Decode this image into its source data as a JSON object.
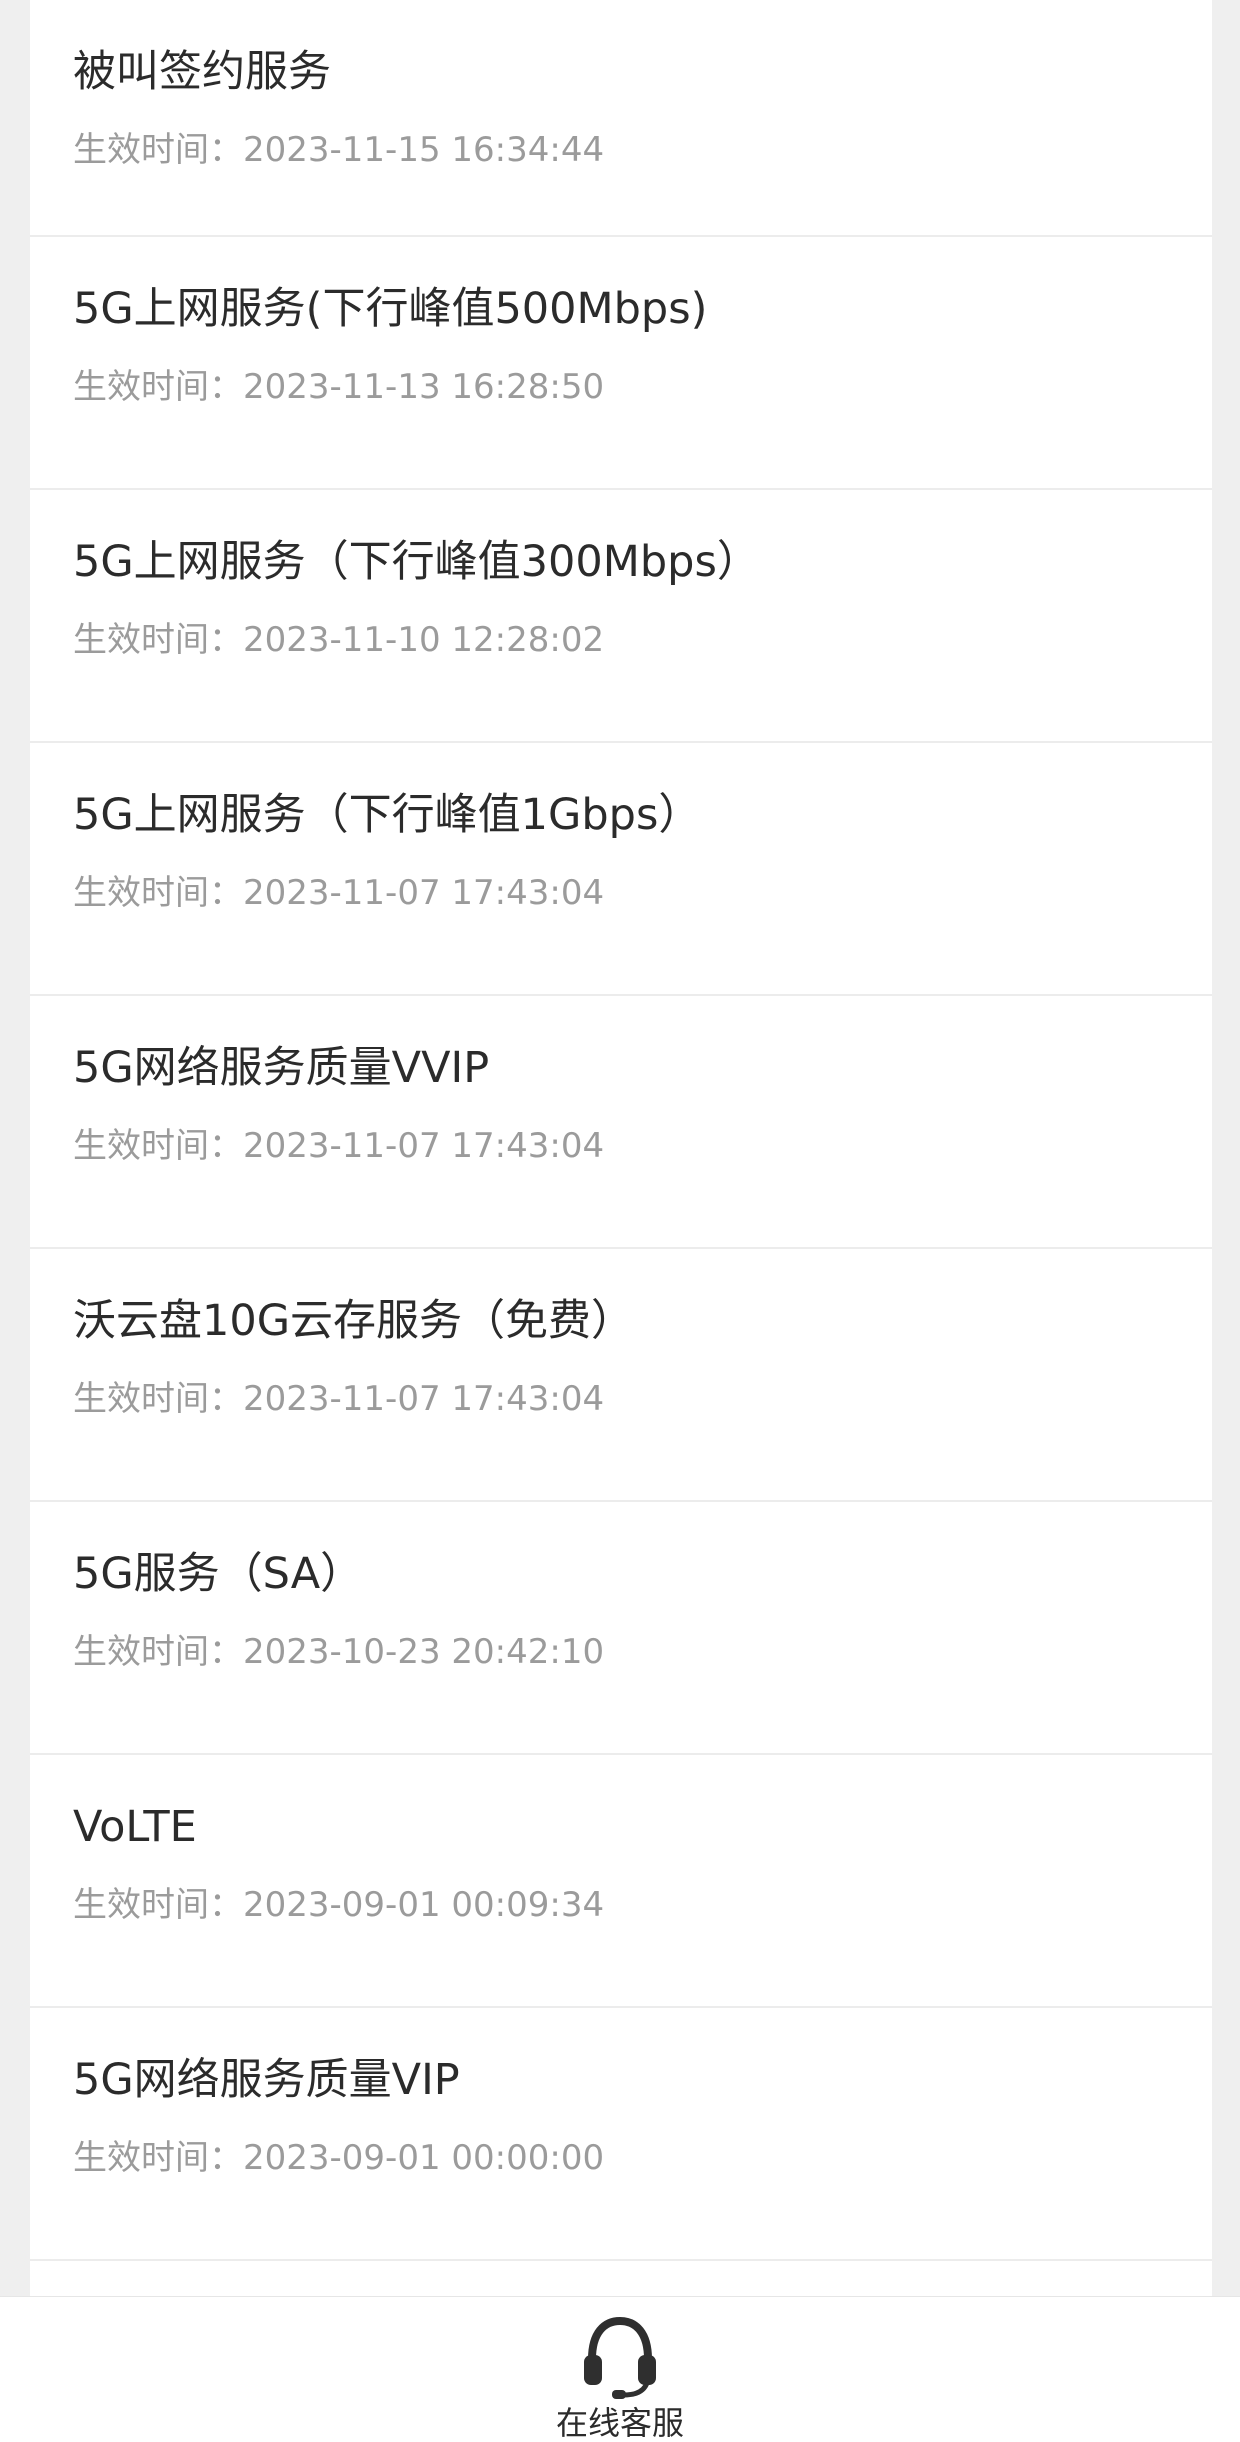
{
  "services": [
    {
      "name": "被叫签约服务",
      "time_label": "生效时间：",
      "time": "2023-11-15 16:34:44"
    },
    {
      "name": "5G上网服务(下行峰值500Mbps)",
      "time_label": "生效时间：",
      "time": "2023-11-13 16:28:50"
    },
    {
      "name": "5G上网服务（下行峰值300Mbps）",
      "time_label": "生效时间：",
      "time": "2023-11-10 12:28:02"
    },
    {
      "name": "5G上网服务（下行峰值1Gbps）",
      "time_label": "生效时间：",
      "time": "2023-11-07 17:43:04"
    },
    {
      "name": "5G网络服务质量VVIP",
      "time_label": "生效时间：",
      "time": "2023-11-07 17:43:04"
    },
    {
      "name": "沃云盘10G云存服务（免费）",
      "time_label": "生效时间：",
      "time": "2023-11-07 17:43:04"
    },
    {
      "name": "5G服务（SA）",
      "time_label": "生效时间：",
      "time": "2023-10-23 20:42:10"
    },
    {
      "name": "VoLTE",
      "time_label": "生效时间：",
      "time": "2023-09-01 00:09:34"
    },
    {
      "name": "5G网络服务质量VIP",
      "time_label": "生效时间：",
      "time": "2023-09-01 00:00:00"
    }
  ],
  "footer": {
    "service_label": "在线客服",
    "service_icon": "headset-icon"
  },
  "colors": {
    "background": "#efefef",
    "card": "#ffffff",
    "title_text": "#2b2b2b",
    "time_text": "#9b9b9b",
    "divider": "#ececec"
  }
}
